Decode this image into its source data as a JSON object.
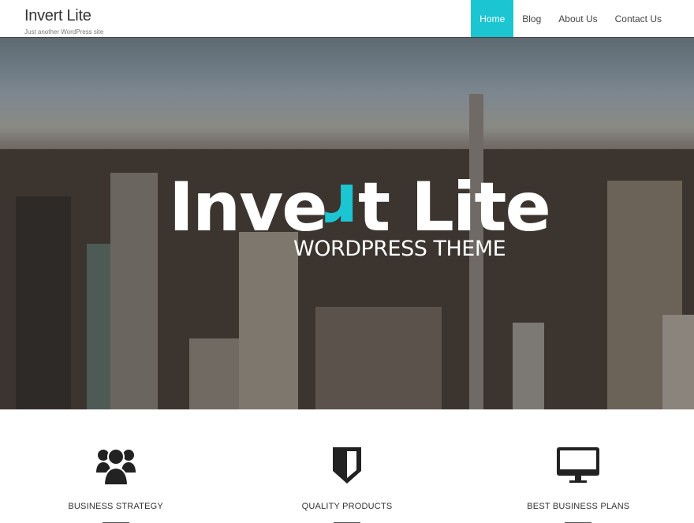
{
  "header": {
    "site_title": "Invert Lite",
    "tagline": "Just another WordPress site",
    "nav": [
      {
        "label": "Home",
        "active": true
      },
      {
        "label": "Blog"
      },
      {
        "label": "About Us"
      },
      {
        "label": "Contact Us"
      }
    ]
  },
  "hero": {
    "title_before": "Inve",
    "title_flipped": "r",
    "title_after": "t Lite",
    "subtitle": "WORDPRESS THEME"
  },
  "features": [
    {
      "icon": "users-icon",
      "label": "BUSINESS STRATEGY"
    },
    {
      "icon": "shield-icon",
      "label": "QUALITY PRODUCTS"
    },
    {
      "icon": "desktop-icon",
      "label": "BEST BUSINESS PLANS"
    }
  ],
  "colors": {
    "accent": "#1bc5d1"
  }
}
